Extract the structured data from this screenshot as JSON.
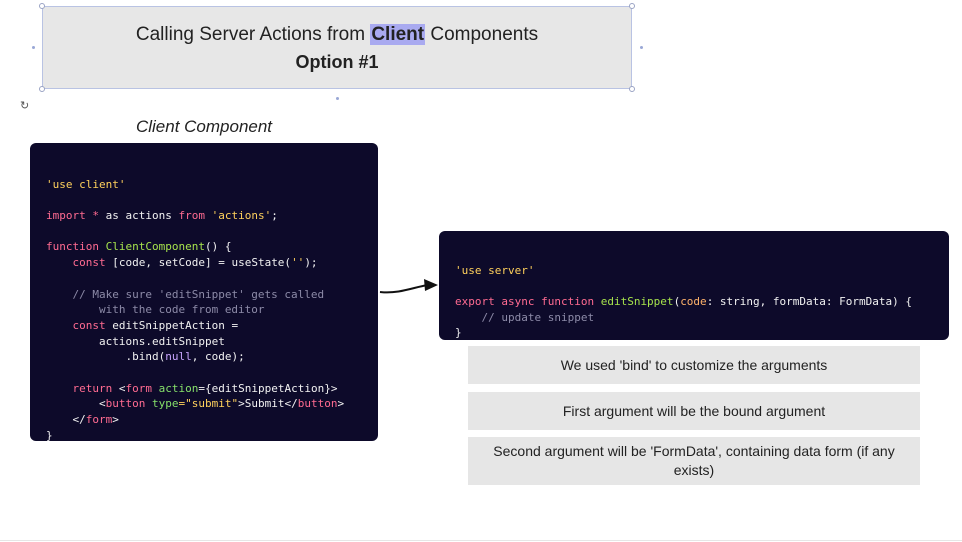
{
  "title": {
    "prefix": "Calling Server Actions from ",
    "highlight": "Client",
    "suffix": " Components",
    "subtitle": "Option #1"
  },
  "client_label": "Client Component",
  "client_code": {
    "use_client": "'use client'",
    "import_kw1": "import",
    "import_star": " * ",
    "import_as": "as actions ",
    "import_from": "from",
    "import_src": "'actions'",
    "import_end": ";",
    "fn_kw": "function",
    "fn_name": "ClientComponent",
    "fn_sig": "() {",
    "const1": "const",
    "state_decl": " [code, setCode] = useState(",
    "state_arg": "''",
    "state_end": ");",
    "comment1": "// Make sure 'editSnippet' gets called",
    "comment2": "with the code from editor",
    "const2": "const",
    "action_decl": " editSnippetAction =",
    "action_ref": "actions.editSnippet",
    "bind_pre": ".bind(",
    "bind_null": "null",
    "bind_post": ", code);",
    "return_kw": "return",
    "form_open": " <",
    "form_tag": "form",
    "form_attr": "action",
    "form_val": "={editSnippetAction}>",
    "button_open": "<",
    "button_tag": "button",
    "button_attr": "type",
    "button_val": "=\"submit\"",
    "button_text": ">Submit</",
    "button_close": "button",
    "button_end": ">",
    "form_close_open": "</",
    "form_close_tag": "form",
    "form_close_end": ">",
    "close_brace": "}"
  },
  "server_code": {
    "use_server": "'use server'",
    "export_kw": "export async function",
    "fn_name": "editSnippet",
    "param_open": "(",
    "param_code": "code",
    "param_code_type": ": string, formData: FormData) {",
    "comment": "// update snippet",
    "close_brace": "}"
  },
  "notes": [
    "We used 'bind' to customize the arguments",
    "First argument will be the bound argument",
    "Second argument will be 'FormData', containing data form (if any exists)"
  ]
}
